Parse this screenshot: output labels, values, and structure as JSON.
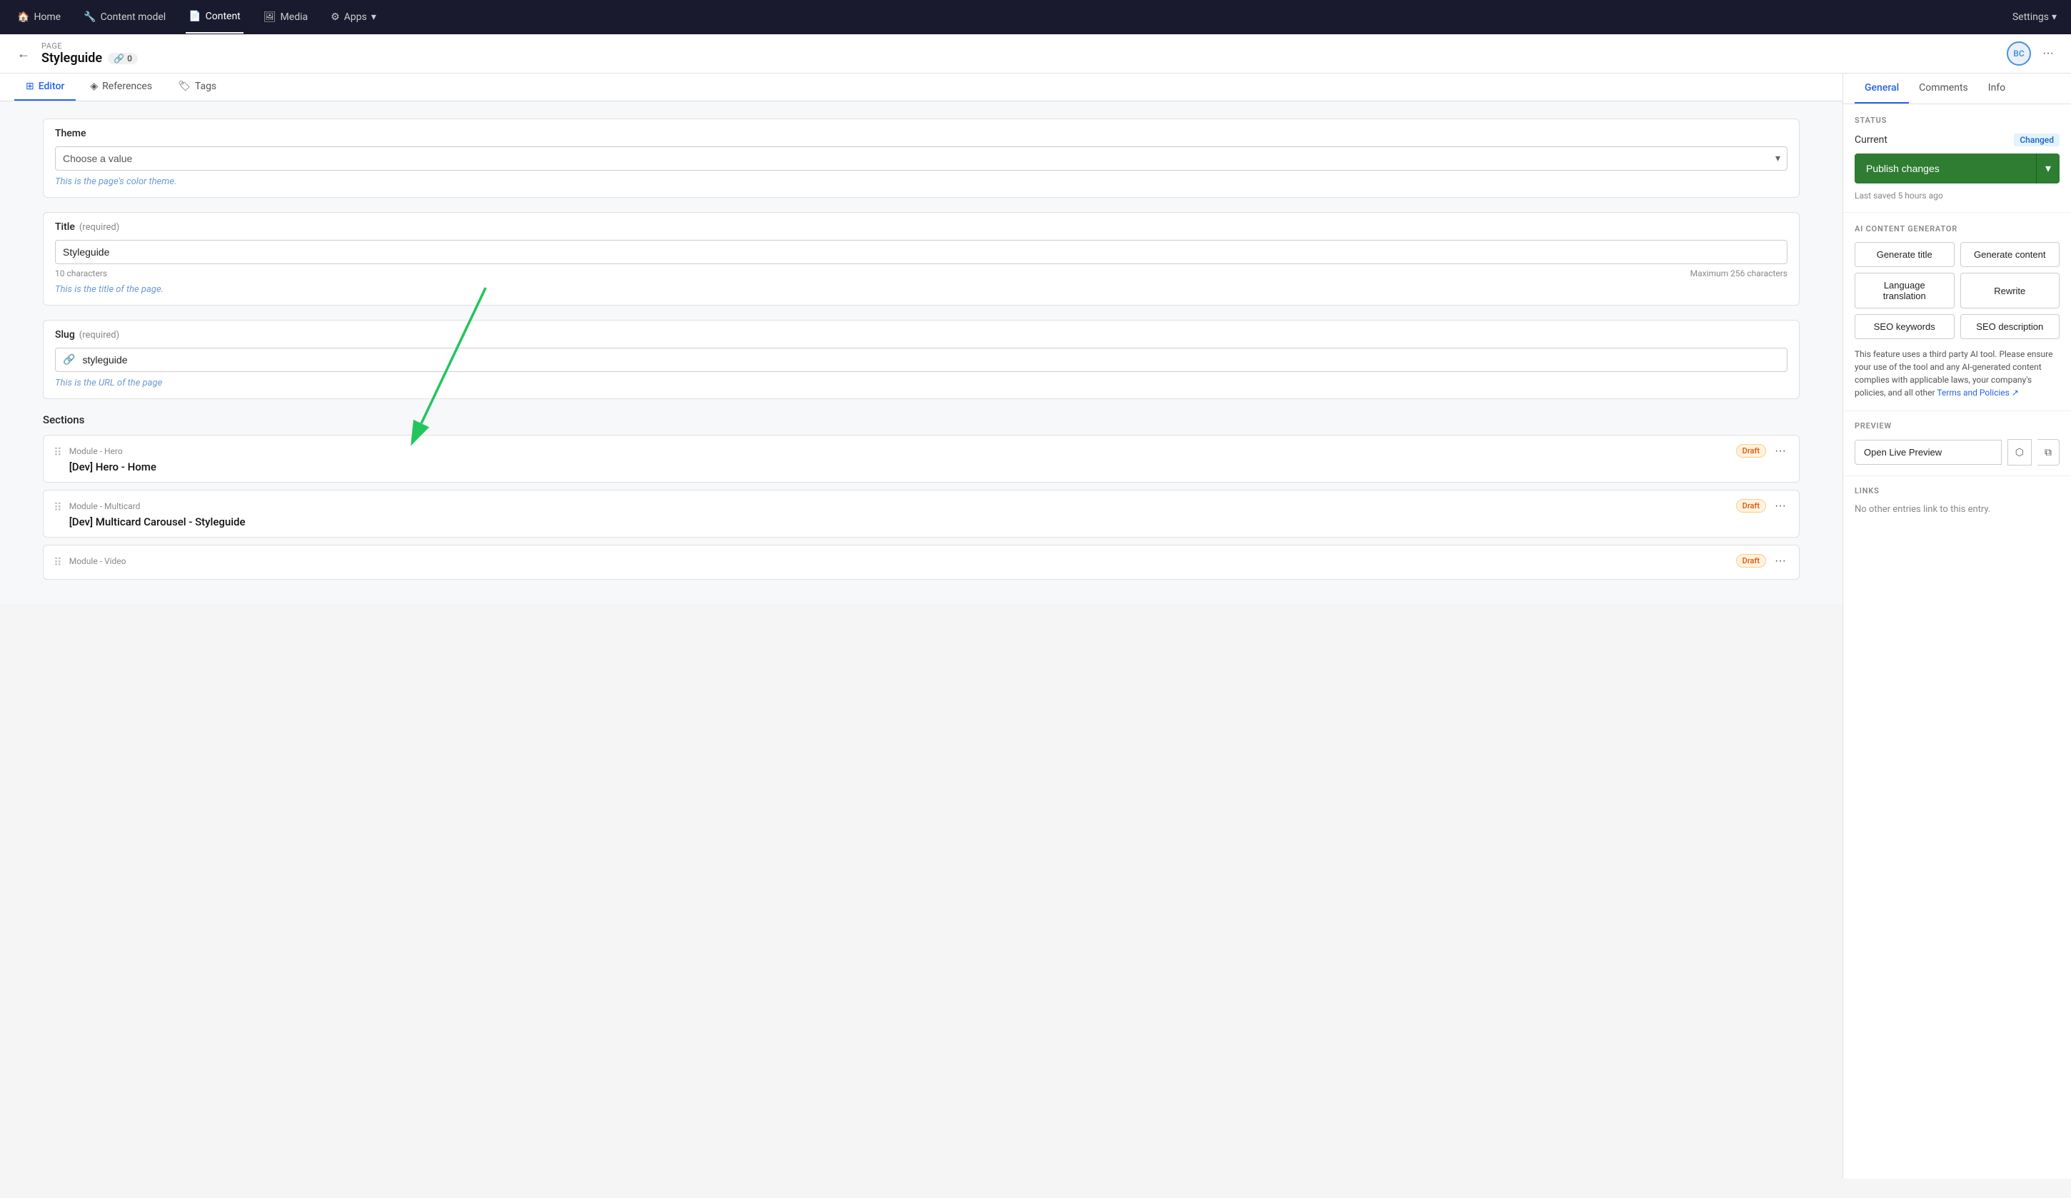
{
  "topNav": {
    "home_label": "Home",
    "content_model_label": "Content model",
    "content_label": "Content",
    "media_label": "Media",
    "apps_label": "Apps",
    "settings_label": "Settings",
    "active": "content"
  },
  "subHeader": {
    "page_label": "Page",
    "page_title": "Styleguide",
    "link_count": "0",
    "avatar_initials": "BC"
  },
  "tabs": {
    "editor_label": "Editor",
    "references_label": "References",
    "tags_label": "Tags",
    "active": "editor"
  },
  "rightTabs": {
    "general_label": "General",
    "comments_label": "Comments",
    "info_label": "Info",
    "active": "general"
  },
  "fields": {
    "theme": {
      "label": "Theme",
      "placeholder": "Choose a value",
      "hint": "This is the page's color theme."
    },
    "title": {
      "label": "Title",
      "required": "(required)",
      "value": "Styleguide",
      "char_count": "10 characters",
      "max_chars": "Maximum 256 characters",
      "hint": "This is the title of the page."
    },
    "slug": {
      "label": "Slug",
      "required": "(required)",
      "value": "styleguide",
      "hint": "This is the URL of the page"
    },
    "sections_label": "Sections",
    "sections": [
      {
        "type": "Module - Hero",
        "name": "[Dev] Hero - Home",
        "badge": "Draft"
      },
      {
        "type": "Module - Multicard",
        "name": "[Dev] Multicard Carousel - Styleguide",
        "badge": "Draft"
      },
      {
        "type": "Module - Video",
        "name": "",
        "badge": "Draft"
      }
    ]
  },
  "rightPanel": {
    "status": {
      "title": "STATUS",
      "current_label": "Current",
      "badge": "Changed",
      "last_saved": "Last saved 5 hours ago"
    },
    "publish": {
      "button_label": "Publish changes"
    },
    "ai": {
      "title": "AI CONTENT GENERATOR",
      "buttons": [
        "Generate title",
        "Generate content",
        "Language translation",
        "Rewrite",
        "SEO keywords",
        "SEO description"
      ],
      "disclaimer": "This feature uses a third party AI tool. Please ensure your use of the tool and any AI-generated content complies with applicable laws, your company's policies, and all other",
      "terms_label": "Terms and Policies",
      "terms_icon": "↗"
    },
    "preview": {
      "title": "PREVIEW",
      "open_label": "Open Live Preview",
      "external_icon": "⬡",
      "copy_icon": "⧉"
    },
    "links": {
      "title": "LINKS",
      "no_links_text": "No other entries link to this entry."
    }
  }
}
